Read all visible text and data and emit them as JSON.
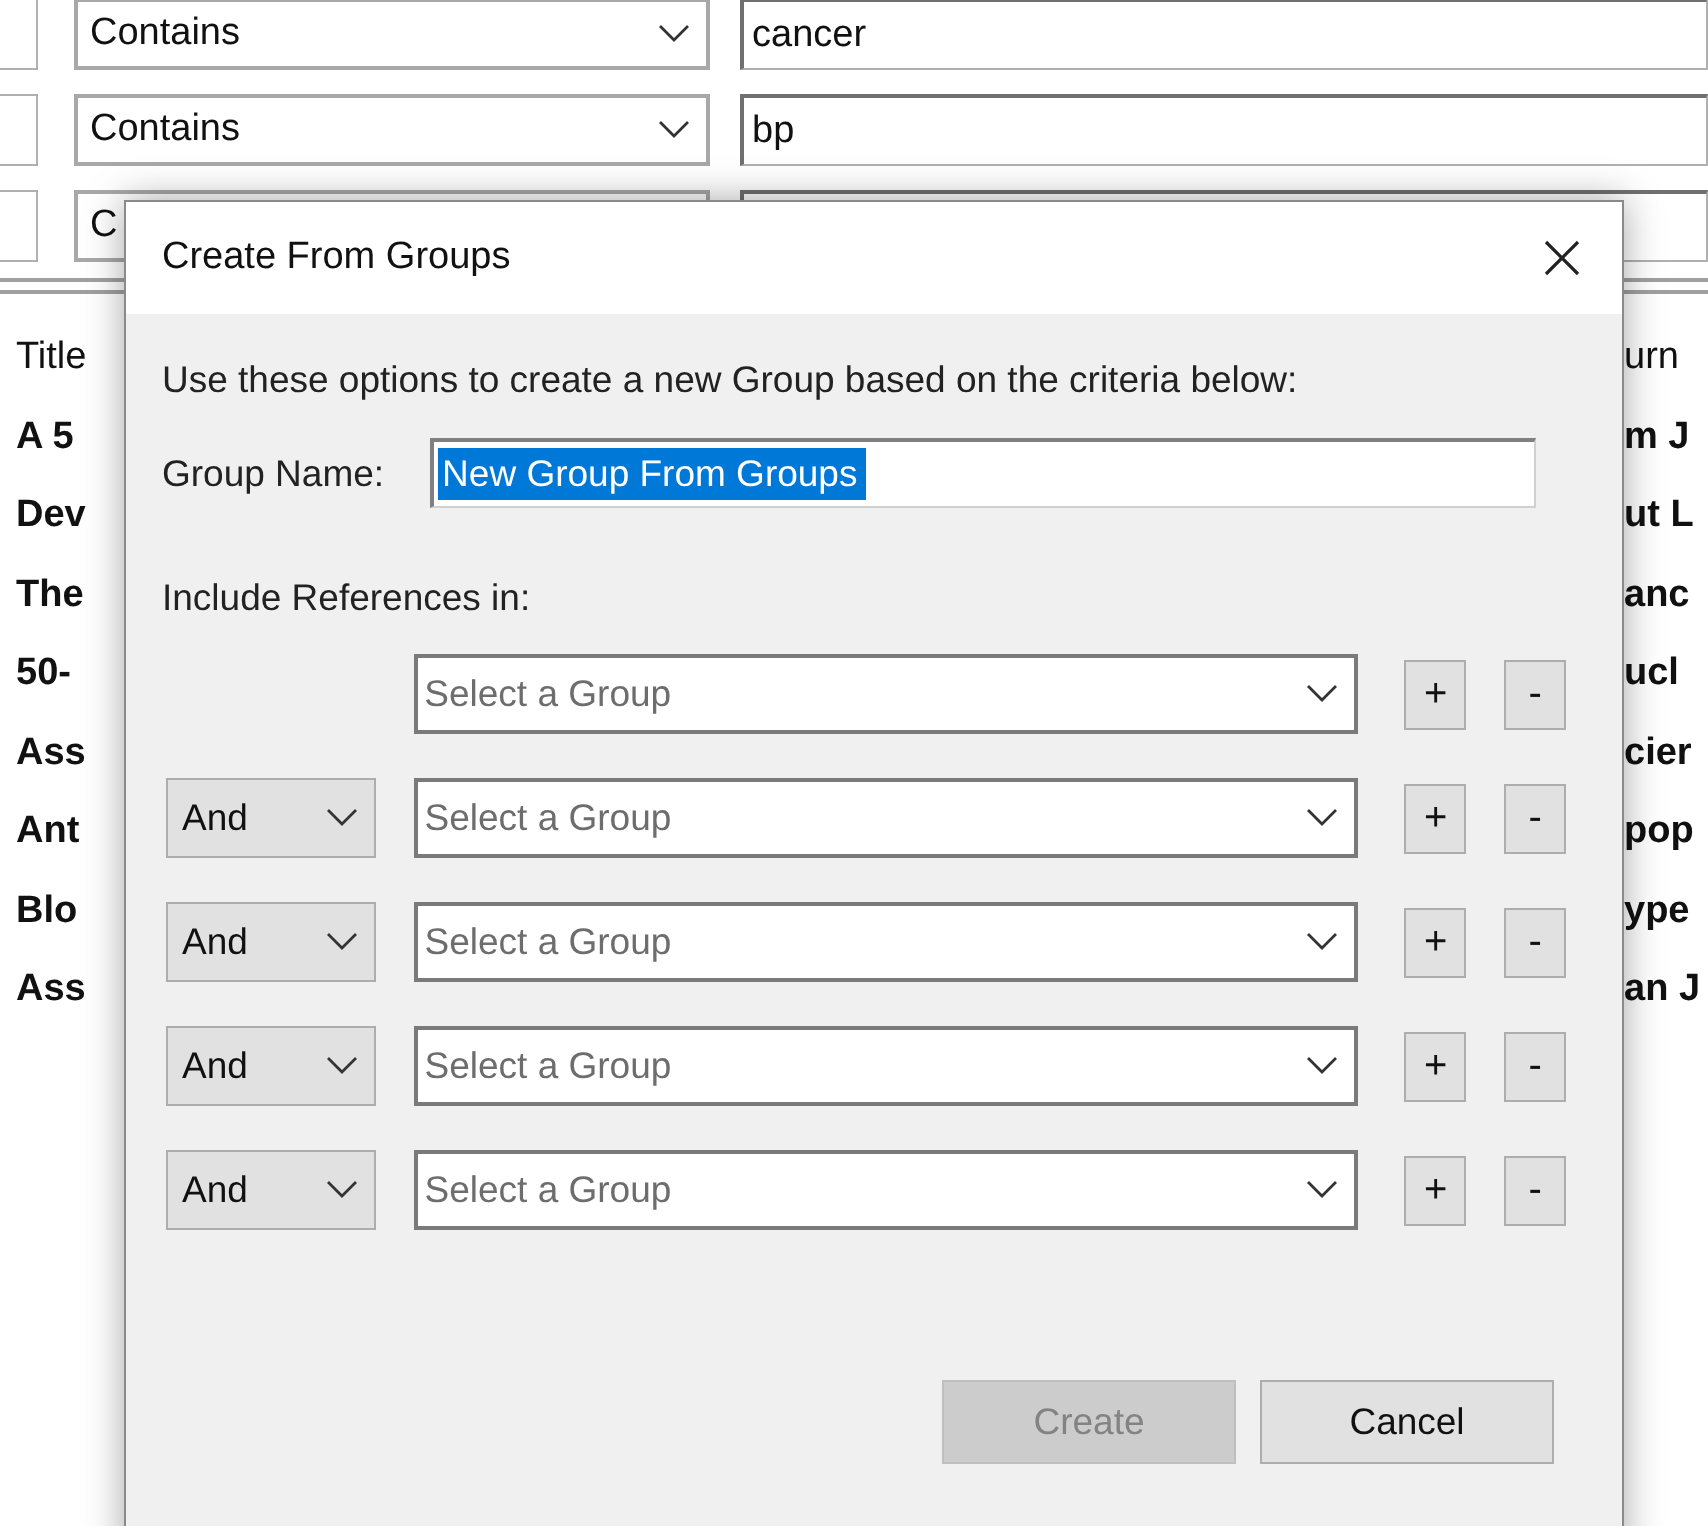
{
  "criteria_rows": [
    {
      "operator": "Contains",
      "value": "cancer"
    },
    {
      "operator": "Contains",
      "value": "bp"
    },
    {
      "operator": "C"
    }
  ],
  "table": {
    "columns": [
      "Title",
      "urn"
    ],
    "rows": [
      {
        "column_1": "A 5",
        "column_2": "m J"
      },
      {
        "column_1": "Dev",
        "column_2": "ut L"
      },
      {
        "column_1": "The",
        "column_2": "anc"
      },
      {
        "column_1": "50-",
        "column_2": "ucl"
      },
      {
        "column_1": "Ass",
        "column_2": "cier"
      },
      {
        "column_1": "Ant",
        "column_2": "pop"
      },
      {
        "column_1": "Blo",
        "column_2": "ype"
      },
      {
        "column_1": "Ass",
        "column_2": "an J"
      }
    ]
  },
  "dialog": {
    "title": "Create From Groups",
    "intro": "Use these options to create a new Group based on the criteria below:",
    "group_name": {
      "label": "Group Name:",
      "value": "New Group From Groups",
      "selected": true
    },
    "include_label": "Include References in:",
    "conditions": [
      {
        "placeholder": "Select a Group",
        "add": "+",
        "remove": "-"
      },
      {
        "operator": "And",
        "placeholder": "Select a Group",
        "add": "+",
        "remove": "-"
      },
      {
        "operator": "And",
        "placeholder": "Select a Group",
        "add": "+",
        "remove": "-"
      },
      {
        "operator": "And",
        "placeholder": "Select a Group",
        "add": "+",
        "remove": "-"
      },
      {
        "operator": "And",
        "placeholder": "Select a Group",
        "add": "+",
        "remove": "-"
      }
    ],
    "buttons": [
      {
        "label": "Create",
        "disabled": true
      },
      {
        "label": "Cancel",
        "disabled": false
      }
    ]
  }
}
